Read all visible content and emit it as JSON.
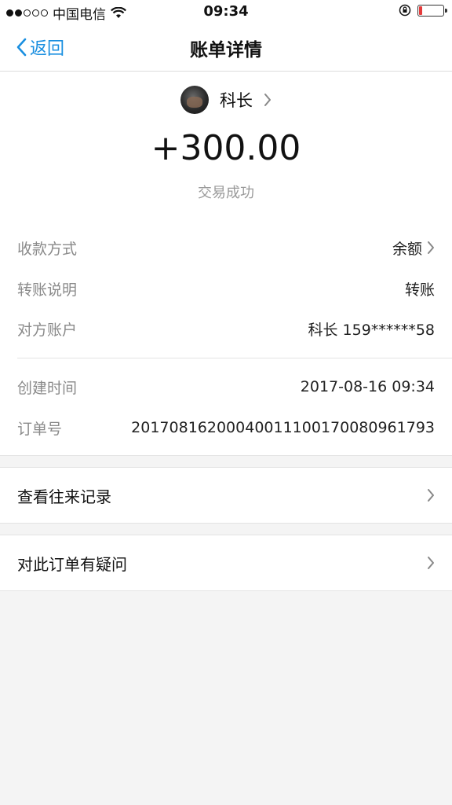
{
  "status_bar": {
    "carrier": "中国电信",
    "time": "09:34",
    "signal_bars_filled": 2,
    "signal_bars_total": 5,
    "battery_level": 0.15
  },
  "nav": {
    "back_label": "返回",
    "title": "账单详情"
  },
  "payee": {
    "name": "科长"
  },
  "amount": "+300.00",
  "status": "交易成功",
  "details": [
    {
      "label": "收款方式",
      "value": "余额"
    },
    {
      "label": "转账说明",
      "value": "转账"
    },
    {
      "label": "对方账户",
      "value": "科长 159******58"
    }
  ],
  "meta": [
    {
      "label": "创建时间",
      "value": "2017-08-16 09:34"
    },
    {
      "label": "订单号",
      "value": "20170816200040011100170080961793"
    }
  ],
  "links": {
    "history": "查看往来记录",
    "question": "对此订单有疑问"
  },
  "colors": {
    "accent": "#1a8fe0",
    "battery_low": "#e53b3b"
  }
}
